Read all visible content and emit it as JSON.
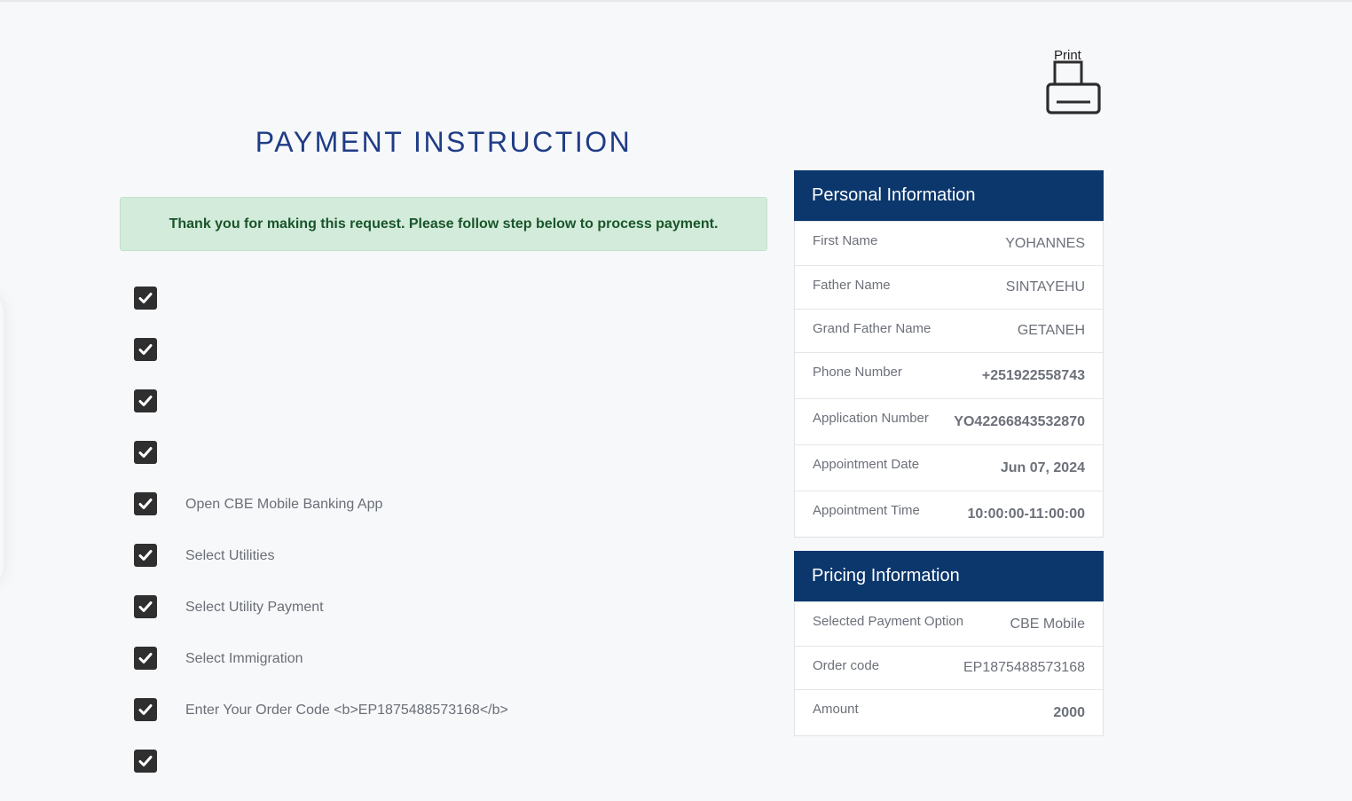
{
  "print": {
    "label": "Print"
  },
  "page_title": "PAYMENT INSTRUCTION",
  "alert_message": "Thank you for making this request. Please follow step below to process payment.",
  "steps": [
    {
      "text": ""
    },
    {
      "text": ""
    },
    {
      "text": ""
    },
    {
      "text": ""
    },
    {
      "text": "Open CBE Mobile Banking App"
    },
    {
      "text": "Select Utilities"
    },
    {
      "text": "Select Utility Payment"
    },
    {
      "text": "Select Immigration"
    },
    {
      "text": "Enter Your Order Code <b>EP1875488573168</b>"
    }
  ],
  "personal_info": {
    "title": "Personal Information",
    "rows": [
      {
        "label": "First Name",
        "value": "YOHANNES"
      },
      {
        "label": "Father Name",
        "value": "SINTAYEHU"
      },
      {
        "label": "Grand Father Name",
        "value": "GETANEH"
      },
      {
        "label": "Phone Number",
        "value": "+251922558743"
      },
      {
        "label": "Application Number",
        "value": "YO42266843532870"
      },
      {
        "label": "Appointment Date",
        "value": "Jun 07, 2024"
      },
      {
        "label": "Appointment Time",
        "value": "10:00:00-11:00:00"
      }
    ]
  },
  "pricing_info": {
    "title": "Pricing Information",
    "rows": [
      {
        "label": "Selected Payment Option",
        "value": "CBE Mobile"
      },
      {
        "label": "Order code",
        "value": "EP1875488573168"
      },
      {
        "label": "Amount",
        "value": "2000"
      }
    ]
  },
  "colors": {
    "header_bg": "#0b376d",
    "title": "#1f3c86",
    "alert_bg": "#d3ebdb",
    "alert_text": "#19552a",
    "checkbox": "#2f2f2f"
  },
  "icons": {
    "print": "printer-icon",
    "check": "check-icon"
  }
}
